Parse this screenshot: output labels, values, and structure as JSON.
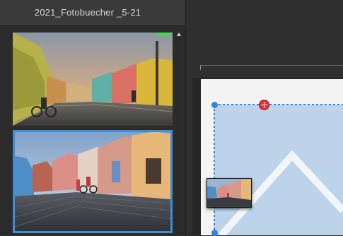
{
  "album": {
    "title": "2021_Fotobuecher _5-21"
  },
  "thumbnails": [
    {
      "name": "street-photo-1",
      "selected": false,
      "used": true
    },
    {
      "name": "street-photo-2",
      "selected": true,
      "used": false
    }
  ],
  "colors": {
    "selection": "#3a8fd6",
    "used_badge": "#49d15a",
    "frame_fill": "#bcd3ea",
    "handle": "#2f86d8",
    "rotate_handle": "#e3303a"
  },
  "icons": {
    "scroll_up": "triangle-up",
    "rotate_handle": "rotate-cross"
  }
}
